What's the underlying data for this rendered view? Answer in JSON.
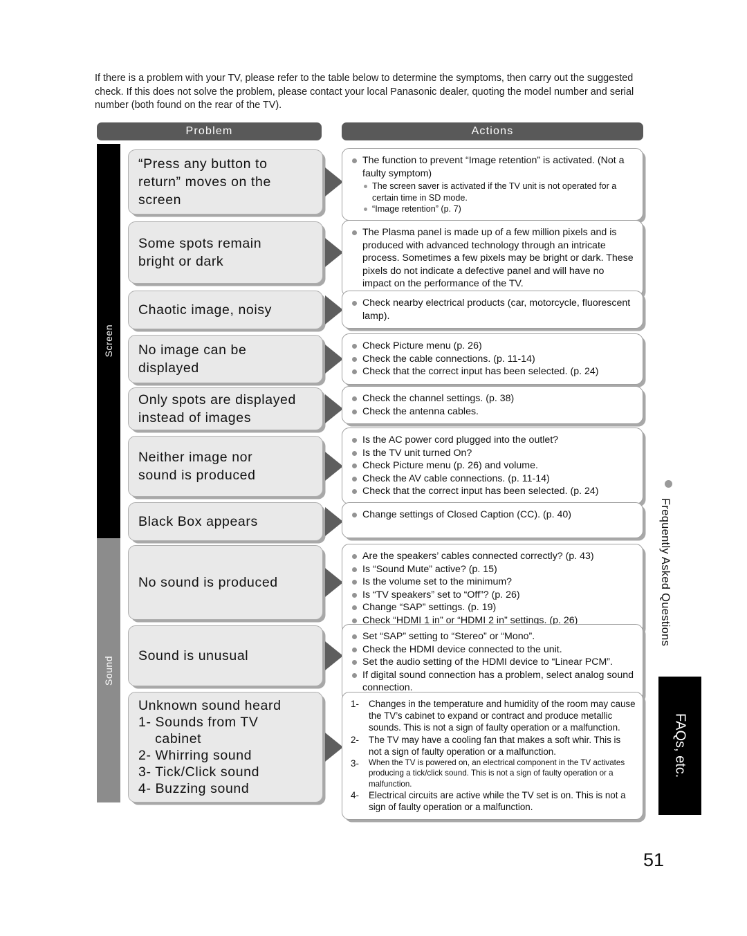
{
  "intro": "If there is a problem with your TV, please refer to the table below to determine the symptoms, then carry out the suggested check. If this does not solve the problem, please contact your local Panasonic dealer, quoting the model number and serial number (both found on the rear of the TV).",
  "headers": {
    "problem": "Problem",
    "actions": "Actions"
  },
  "categories": [
    {
      "label": "Screen",
      "color": "#000000"
    },
    {
      "label": "Sound",
      "color": "#8c8c8c"
    }
  ],
  "rows": [
    {
      "problem": [
        "“Press any button to",
        "return” moves on the",
        "screen"
      ],
      "actions": [
        {
          "text": "The function to prevent “Image retention” is activated. (Not a faulty symptom)",
          "sub": [
            "The screen saver is activated if the TV unit is not operated for a certain time in SD mode.",
            "“Image retention” (p. 7)"
          ]
        }
      ]
    },
    {
      "problem": [
        "Some spots remain",
        "bright or dark"
      ],
      "actions": [
        {
          "text": "The Plasma panel is made up of a few million pixels and is produced with advanced technology through an intricate process. Sometimes a few pixels may be bright or dark. These pixels do not indicate a defective panel and will have no impact on the performance of the TV."
        }
      ]
    },
    {
      "problem": [
        "Chaotic image, noisy"
      ],
      "actions": [
        {
          "text": "Check nearby electrical products (car, motorcycle, fluorescent lamp)."
        }
      ]
    },
    {
      "problem": [
        "No image can be",
        "displayed"
      ],
      "actions": [
        {
          "text": "Check Picture menu (p. 26)"
        },
        {
          "text": "Check the cable connections. (p. 11-14)"
        },
        {
          "text": "Check that the correct input has been selected. (p. 24)"
        }
      ]
    },
    {
      "problem": [
        "Only spots are displayed",
        "instead of images"
      ],
      "actions": [
        {
          "text": "Check the channel settings. (p. 38)"
        },
        {
          "text": "Check the antenna cables."
        }
      ]
    },
    {
      "problem": [
        "Neither image nor",
        "sound is produced"
      ],
      "actions": [
        {
          "text": "Is the AC power cord plugged into the outlet?"
        },
        {
          "text": "Is the TV unit turned On?"
        },
        {
          "text": "Check Picture menu (p. 26) and volume."
        },
        {
          "text": "Check the AV cable connections. (p. 11-14)"
        },
        {
          "text": "Check that the correct input has been selected. (p. 24)"
        }
      ]
    },
    {
      "problem": [
        "Black Box appears"
      ],
      "actions": [
        {
          "text": "Change settings of Closed Caption (CC). (p. 40)"
        }
      ]
    },
    {
      "problem": [
        "No sound is produced"
      ],
      "actions": [
        {
          "text": "Are the speakers’ cables connected correctly? (p. 43)"
        },
        {
          "text": "Is “Sound Mute” active? (p. 15)"
        },
        {
          "text": "Is the volume set to the minimum?"
        },
        {
          "text": "Is “TV speakers” set to “Off”? (p. 26)"
        },
        {
          "text": "Change “SAP” settings. (p. 19)"
        },
        {
          "text": "Check “HDMI 1 in” or “HDMI 2 in” settings. (p. 26)"
        }
      ]
    },
    {
      "problem": [
        "Sound is unusual"
      ],
      "actions": [
        {
          "text": "Set “SAP” setting to “Stereo” or “Mono”."
        },
        {
          "text": "Check the HDMI device connected to the unit."
        },
        {
          "text": "Set the audio setting of the HDMI device to “Linear PCM”."
        },
        {
          "text": "If digital sound connection has a problem, select analog sound connection."
        }
      ]
    },
    {
      "problem": [
        "Unknown sound heard",
        "1- Sounds from TV",
        "    cabinet",
        "2- Whirring sound",
        "3- Tick/Click sound",
        "4- Buzzing sound"
      ],
      "numbered_actions": [
        {
          "num": "1-",
          "text": "Changes in the temperature and humidity of the room may cause the TV’s cabinet to expand or contract and produce metallic sounds. This is not a sign of faulty operation or a malfunction.",
          "small": false
        },
        {
          "num": "2-",
          "text": "The TV may have a cooling fan that makes a soft whir. This is not a sign of faulty operation or a malfunction.",
          "small": false
        },
        {
          "num": "3-",
          "text": "When the TV is powered on, an electrical component in the TV activates producing a tick/click sound. This is not a sign of faulty operation or a malfunction.",
          "small": true
        },
        {
          "num": "4-",
          "text": "Electrical circuits are active while the TV set is on. This is not a sign of faulty operation or a malfunction.",
          "small": false
        }
      ]
    }
  ],
  "side_tab": {
    "section_label": "Frequently Asked Questions",
    "chapter_label": "FAQs, etc."
  },
  "page_number": "51"
}
